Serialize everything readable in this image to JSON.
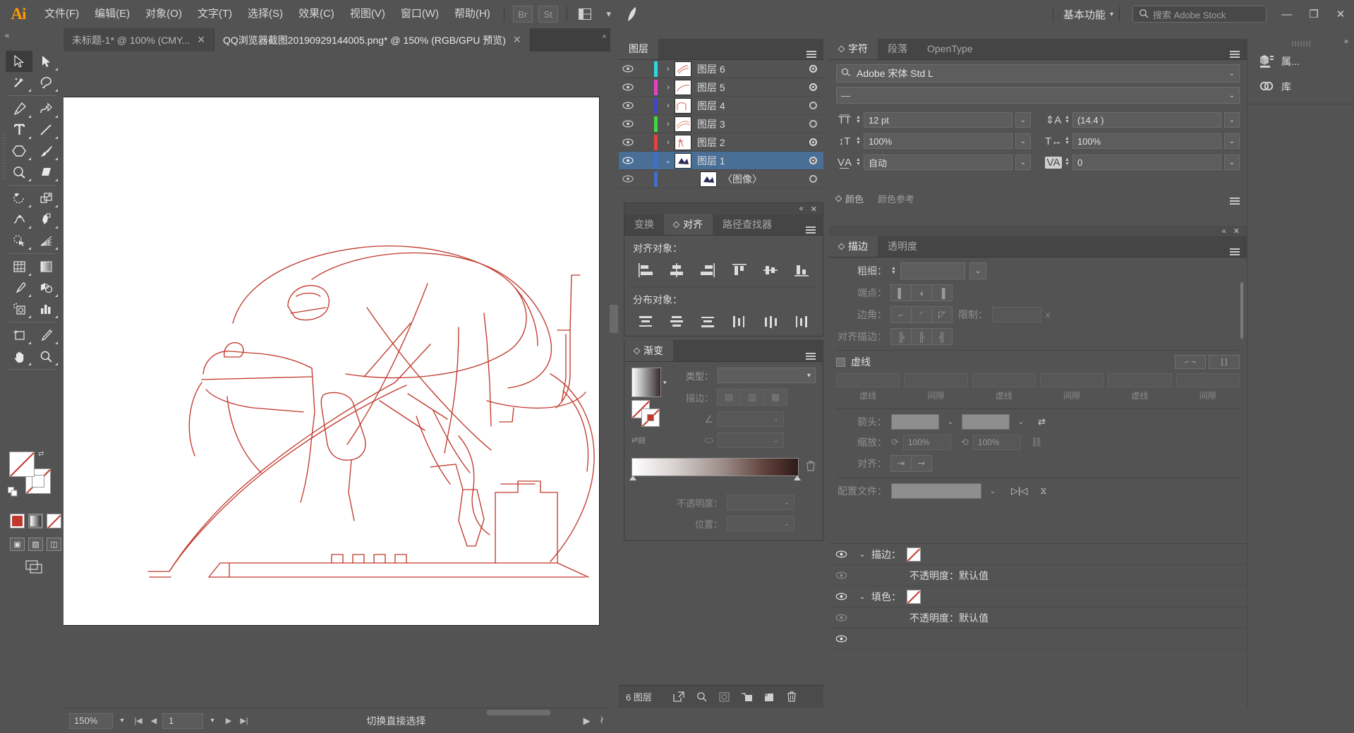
{
  "app": {
    "logo": "Ai",
    "title": "Adobe Illustrator"
  },
  "menubar": {
    "items": [
      {
        "label": "文件(F)"
      },
      {
        "label": "编辑(E)"
      },
      {
        "label": "对象(O)"
      },
      {
        "label": "文字(T)"
      },
      {
        "label": "选择(S)"
      },
      {
        "label": "效果(C)"
      },
      {
        "label": "视图(V)"
      },
      {
        "label": "窗口(W)"
      },
      {
        "label": "帮助(H)"
      }
    ],
    "bridge_label": "Br",
    "stock_label": "St",
    "workspace": "基本功能",
    "search_placeholder": "搜索 Adobe Stock",
    "minimize": "—",
    "restore": "❐",
    "close": "✕"
  },
  "tabs": [
    {
      "label": "未标题-1* @ 100% (CMY...",
      "active": false,
      "close": "✕"
    },
    {
      "label": "QQ浏览器截图20190929144005.png* @ 150% (RGB/GPU 预览)",
      "active": true,
      "close": "✕"
    }
  ],
  "toolbar": {
    "tools": [
      {
        "name": "selection-tool",
        "selected": true
      },
      {
        "name": "direct-selection-tool",
        "selected": false
      },
      {
        "name": "magic-wand-tool",
        "selected": false
      },
      {
        "name": "lasso-tool",
        "selected": false
      },
      {
        "name": "pen-tool",
        "selected": false
      },
      {
        "name": "curvature-tool",
        "selected": false
      },
      {
        "name": "type-tool",
        "selected": false
      },
      {
        "name": "line-segment-tool",
        "selected": false
      },
      {
        "name": "rectangle-tool",
        "selected": false
      },
      {
        "name": "paintbrush-tool",
        "selected": false
      },
      {
        "name": "shaper-tool",
        "selected": false
      },
      {
        "name": "eraser-tool",
        "selected": false
      },
      {
        "name": "rotate-tool",
        "selected": false
      },
      {
        "name": "scale-tool",
        "selected": false
      },
      {
        "name": "width-tool",
        "selected": false
      },
      {
        "name": "free-transform-tool",
        "selected": false
      },
      {
        "name": "shape-builder-tool",
        "selected": false
      },
      {
        "name": "perspective-grid-tool",
        "selected": false
      },
      {
        "name": "mesh-tool",
        "selected": false
      },
      {
        "name": "gradient-tool",
        "selected": false
      },
      {
        "name": "eyedropper-tool",
        "selected": false
      },
      {
        "name": "blend-tool",
        "selected": false
      },
      {
        "name": "symbol-sprayer-tool",
        "selected": false
      },
      {
        "name": "column-graph-tool",
        "selected": false
      },
      {
        "name": "artboard-tool",
        "selected": false
      },
      {
        "name": "slice-tool",
        "selected": false
      },
      {
        "name": "hand-tool",
        "selected": false
      },
      {
        "name": "zoom-tool",
        "selected": false
      }
    ]
  },
  "statusbar": {
    "zoom": "150%",
    "page": "1",
    "message": "切换直接选择"
  },
  "layers_panel": {
    "tab": "图层",
    "rows": [
      {
        "name": "图层 6",
        "color": "#2fd8e0",
        "visible": true,
        "selected": false,
        "expanded": false,
        "sub": false
      },
      {
        "name": "图层 5",
        "color": "#e83fc4",
        "visible": true,
        "selected": false,
        "expanded": false,
        "sub": false
      },
      {
        "name": "图层 4",
        "color": "#3f48cc",
        "visible": true,
        "selected": false,
        "expanded": false,
        "sub": false
      },
      {
        "name": "图层 3",
        "color": "#3fd83f",
        "visible": true,
        "selected": false,
        "expanded": false,
        "sub": false
      },
      {
        "name": "图层 2",
        "color": "#e84040",
        "visible": true,
        "selected": false,
        "expanded": false,
        "sub": false
      },
      {
        "name": "图层 1",
        "color": "#3f6fcc",
        "visible": true,
        "selected": true,
        "expanded": true,
        "sub": false
      },
      {
        "name": "〈图像〉",
        "color": "#3f6fcc",
        "visible": true,
        "selected": false,
        "expanded": false,
        "sub": true
      }
    ],
    "footer_count": "6 图层"
  },
  "align_panel": {
    "tabs": [
      {
        "label": "变换",
        "active": false
      },
      {
        "label": "对齐",
        "active": true
      },
      {
        "label": "路径查找器",
        "active": false
      }
    ],
    "align_objects_label": "对齐对象：",
    "distribute_objects_label": "分布对象：",
    "align_icons": [
      "align-left",
      "align-horizontal-center",
      "align-right",
      "align-top",
      "align-vertical-center",
      "align-bottom"
    ],
    "distribute_icons": [
      "distribute-top",
      "distribute-vertical-center",
      "distribute-bottom",
      "distribute-left",
      "distribute-horizontal-center",
      "distribute-right"
    ]
  },
  "gradient_panel": {
    "tab": "渐变",
    "type_label": "类型：",
    "type_value": "",
    "stroke_label": "描边：",
    "angle_label": "",
    "aspect_label": "",
    "opacity_label": "不透明度：",
    "opacity_value": "",
    "location_label": "位置：",
    "location_value": "",
    "gradient_start": "#ffffff",
    "gradient_end": "#2e1a18"
  },
  "character_panel": {
    "tabs": [
      {
        "label": "字符",
        "active": true
      },
      {
        "label": "段落",
        "active": false
      },
      {
        "label": "OpenType",
        "active": false
      }
    ],
    "font_family": "Adobe 宋体 Std L",
    "font_style": "—",
    "font_size": "12 pt",
    "leading": "(14.4 )",
    "vertical_scale": "100%",
    "horizontal_scale": "100%",
    "kerning": "自动",
    "tracking": "0"
  },
  "color_tabs": [
    {
      "label": "颜色",
      "active": true
    },
    {
      "label": "颜色参考",
      "active": false
    }
  ],
  "stroke_panel": {
    "tabs": [
      {
        "label": "描边",
        "active": true
      },
      {
        "label": "透明度",
        "active": false
      }
    ],
    "weight_label": "粗细：",
    "weight_value": "",
    "cap_label": "端点：",
    "corner_label": "边角：",
    "limit_label": "限制：",
    "limit_value": "",
    "limit_unit": "x",
    "align_stroke_label": "对齐描边：",
    "dashed_label": "虚线",
    "dash_labels": [
      "虚线",
      "间隙",
      "虚线",
      "间隙",
      "虚线",
      "间隙"
    ],
    "arrow_label": "箭头：",
    "scale_label": "缩放：",
    "scale_start": "100%",
    "scale_end": "100%",
    "align_label": "对齐：",
    "profile_label": "配置文件："
  },
  "appearance_panel": {
    "rows": [
      {
        "label": "描边：",
        "type": "swatch",
        "indent": false,
        "eye": true
      },
      {
        "label": "不透明度：默认值",
        "type": "text",
        "indent": true,
        "eye": false
      },
      {
        "label": "填色：",
        "type": "swatch",
        "indent": false,
        "eye": true
      },
      {
        "label": "不透明度：默认值",
        "type": "text",
        "indent": true,
        "eye": false
      }
    ]
  },
  "right_rail": {
    "items": [
      {
        "label": "属...",
        "icon": "properties-icon"
      },
      {
        "label": "库",
        "icon": "libraries-icon"
      }
    ]
  },
  "colors": {
    "chrome": "#535353",
    "panel_dark": "#454545",
    "selection_blue": "#4a6f96",
    "accent_orange": "#ff9a00",
    "artwork_stroke": "#c0392b"
  }
}
